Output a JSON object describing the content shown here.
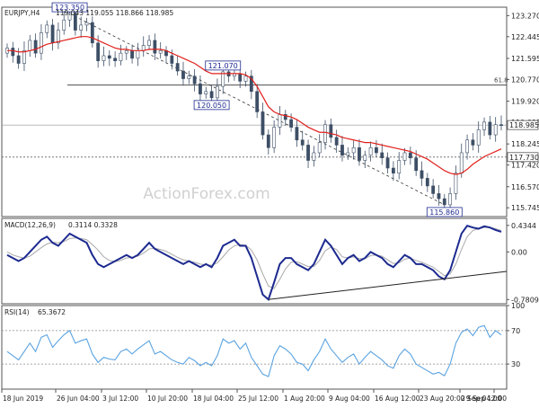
{
  "colors": {
    "background": "#ffffff",
    "border": "#555555",
    "price_bars": "#3d4f66",
    "ma": "#e0201b",
    "macd": "#1d2a90",
    "signal": "#a9a9a9",
    "rsi": "#5aa3e0",
    "trendline": "#222222",
    "dotted": "#333333",
    "label_box_border": "#1d2a90",
    "label_text": "#1d2a90",
    "price_label_bg": "#ffffff",
    "watermark": "#d0d0d0"
  },
  "watermark": "ActionForex.com",
  "chart_data": [
    {
      "panel": "price",
      "type": "candlestick",
      "header": {
        "symbol": "EURJPY,H4",
        "ohlc": "119.043 119.055 118.866 118.985"
      },
      "ylim": [
        115.4,
        123.6
      ],
      "y_ticks": [
        "123.270",
        "122.445",
        "121.595",
        "120.770",
        "119.920",
        "119.095",
        "118.245",
        "117.420",
        "116.570",
        "115.745"
      ],
      "y_tick_values": [
        123.27,
        122.445,
        121.595,
        120.77,
        119.92,
        119.095,
        118.245,
        117.42,
        116.57,
        115.745
      ],
      "x_tick_labels": [
        "18 Jun 2019",
        "26 Jun 04:00",
        "3 Jul 12:00",
        "10 Jul 20:00",
        "18 Jul 04:00",
        "25 Jul 12:00",
        "1 Aug 20:00",
        "9 Aug 04:00",
        "16 Aug 12:00",
        "23 Aug 20:00",
        "2 Sep 04:00",
        "9 Sep 12:00"
      ],
      "close_series": [
        122.0,
        121.7,
        121.4,
        121.9,
        122.3,
        121.8,
        122.6,
        122.9,
        122.2,
        122.7,
        123.1,
        123.35,
        122.7,
        122.9,
        123.0,
        122.2,
        121.5,
        121.7,
        121.6,
        121.5,
        121.8,
        121.9,
        121.6,
        121.9,
        122.1,
        122.3,
        121.8,
        121.9,
        121.7,
        121.4,
        121.1,
        120.8,
        120.9,
        120.6,
        120.2,
        120.3,
        120.05,
        120.5,
        121.07,
        120.9,
        121.0,
        120.7,
        120.9,
        120.3,
        119.5,
        118.6,
        118.1,
        118.9,
        119.4,
        119.2,
        118.9,
        118.4,
        118.2,
        117.6,
        117.9,
        118.3,
        119.0,
        118.5,
        118.2,
        117.8,
        117.9,
        118.1,
        117.6,
        117.8,
        118.1,
        117.9,
        117.7,
        117.3,
        117.1,
        117.6,
        117.9,
        117.7,
        117.2,
        116.9,
        116.6,
        116.3,
        116.1,
        115.86,
        116.3,
        117.1,
        117.9,
        118.4,
        118.2,
        118.8,
        119.1,
        118.6,
        119.0,
        118.985
      ],
      "ma_series": [
        121.9,
        121.9,
        121.85,
        121.85,
        121.9,
        121.95,
        122.05,
        122.15,
        122.2,
        122.25,
        122.3,
        122.35,
        122.4,
        122.45,
        122.45,
        122.4,
        122.3,
        122.2,
        122.1,
        122.0,
        121.95,
        121.95,
        121.9,
        121.9,
        121.9,
        121.95,
        121.95,
        121.95,
        121.9,
        121.8,
        121.7,
        121.6,
        121.5,
        121.4,
        121.25,
        121.1,
        121.0,
        121.0,
        121.0,
        121.0,
        121.0,
        121.0,
        120.95,
        120.8,
        120.5,
        120.1,
        119.7,
        119.5,
        119.4,
        119.35,
        119.3,
        119.2,
        119.05,
        118.9,
        118.8,
        118.7,
        118.7,
        118.65,
        118.6,
        118.5,
        118.45,
        118.4,
        118.35,
        118.3,
        118.3,
        118.25,
        118.2,
        118.15,
        118.1,
        118.05,
        118.0,
        117.95,
        117.85,
        117.75,
        117.65,
        117.5,
        117.35,
        117.2,
        117.1,
        117.05,
        117.1,
        117.25,
        117.45,
        117.6,
        117.75,
        117.85,
        117.95,
        118.05
      ],
      "annotations": [
        {
          "text": "123.350",
          "value": 123.35,
          "index": 11,
          "place": "above"
        },
        {
          "text": "121.070",
          "value": 121.07,
          "index": 38,
          "place": "above"
        },
        {
          "text": "120.050",
          "value": 120.05,
          "index": 36,
          "place": "below"
        },
        {
          "text": "115.860",
          "value": 115.86,
          "index": 77,
          "place": "below"
        }
      ],
      "fib": {
        "label": "61.8",
        "value": 120.55
      },
      "hlines": [
        {
          "value": 118.985,
          "style": "thin",
          "label": "118.985"
        },
        {
          "value": 117.73,
          "style": "dotted",
          "label": "117.730"
        }
      ],
      "trendline_from": [
        11,
        123.35
      ],
      "trendline_to": [
        77,
        115.86
      ]
    },
    {
      "panel": "macd",
      "type": "line",
      "header": {
        "name": "MACD(12,26,9)",
        "values": "0.3114 0.3328"
      },
      "ylim": [
        -0.85,
        0.55
      ],
      "y_ticks": [
        "0.4344",
        "0.00",
        "-0.7809"
      ],
      "y_tick_values": [
        0.4344,
        0.0,
        -0.7809
      ],
      "series": [
        {
          "name": "MACD",
          "values": [
            -0.05,
            -0.1,
            -0.15,
            -0.1,
            0.0,
            0.1,
            0.2,
            0.25,
            0.15,
            0.1,
            0.2,
            0.3,
            0.25,
            0.2,
            0.15,
            -0.05,
            -0.2,
            -0.25,
            -0.2,
            -0.15,
            -0.1,
            -0.05,
            -0.1,
            -0.05,
            0.05,
            0.15,
            0.05,
            0.0,
            -0.05,
            -0.1,
            -0.15,
            -0.2,
            -0.15,
            -0.2,
            -0.25,
            -0.2,
            -0.25,
            -0.1,
            0.1,
            0.15,
            0.2,
            0.1,
            0.1,
            -0.1,
            -0.4,
            -0.7,
            -0.78,
            -0.5,
            -0.2,
            -0.1,
            -0.1,
            -0.2,
            -0.25,
            -0.3,
            -0.2,
            0.0,
            0.2,
            0.1,
            -0.05,
            -0.2,
            -0.1,
            -0.05,
            -0.15,
            -0.1,
            0.0,
            -0.05,
            -0.1,
            -0.2,
            -0.25,
            -0.15,
            -0.05,
            -0.1,
            -0.2,
            -0.2,
            -0.25,
            -0.3,
            -0.4,
            -0.45,
            -0.3,
            0.0,
            0.3,
            0.43,
            0.4,
            0.38,
            0.42,
            0.4,
            0.36,
            0.33
          ]
        },
        {
          "name": "Signal",
          "values": [
            0.0,
            -0.05,
            -0.08,
            -0.1,
            -0.07,
            0.0,
            0.07,
            0.13,
            0.16,
            0.15,
            0.17,
            0.22,
            0.23,
            0.22,
            0.2,
            0.12,
            0.03,
            -0.08,
            -0.14,
            -0.16,
            -0.14,
            -0.1,
            -0.09,
            -0.07,
            -0.02,
            0.05,
            0.06,
            0.04,
            0.01,
            -0.04,
            -0.09,
            -0.13,
            -0.15,
            -0.17,
            -0.2,
            -0.21,
            -0.22,
            -0.18,
            -0.08,
            0.03,
            0.1,
            0.12,
            0.11,
            0.03,
            -0.13,
            -0.36,
            -0.56,
            -0.6,
            -0.45,
            -0.28,
            -0.17,
            -0.16,
            -0.2,
            -0.24,
            -0.24,
            -0.14,
            0.02,
            0.08,
            0.04,
            -0.08,
            -0.1,
            -0.08,
            -0.11,
            -0.11,
            -0.06,
            -0.05,
            -0.07,
            -0.13,
            -0.19,
            -0.18,
            -0.12,
            -0.1,
            -0.14,
            -0.17,
            -0.21,
            -0.25,
            -0.32,
            -0.39,
            -0.36,
            -0.2,
            0.04,
            0.25,
            0.35,
            0.38,
            0.4,
            0.4,
            0.38,
            0.35
          ]
        }
      ],
      "trendline_from": [
        46,
        -0.78
      ],
      "trendline_to": [
        87,
        -0.32
      ]
    },
    {
      "panel": "rsi",
      "type": "line",
      "header": {
        "name": "RSI(14)",
        "values": "65.3672"
      },
      "ylim": [
        0,
        100
      ],
      "y_ticks": [
        "100",
        "70",
        "30",
        "0"
      ],
      "y_tick_values": [
        100,
        70,
        30,
        0
      ],
      "series": [
        {
          "name": "RSI",
          "values": [
            45,
            40,
            35,
            45,
            55,
            45,
            62,
            65,
            50,
            58,
            65,
            70,
            55,
            58,
            60,
            42,
            32,
            38,
            36,
            35,
            45,
            48,
            42,
            48,
            53,
            58,
            42,
            45,
            40,
            35,
            32,
            30,
            38,
            34,
            28,
            32,
            28,
            40,
            60,
            55,
            58,
            48,
            55,
            38,
            28,
            18,
            15,
            40,
            52,
            48,
            42,
            32,
            30,
            22,
            35,
            45,
            60,
            48,
            40,
            32,
            38,
            42,
            30,
            38,
            45,
            40,
            35,
            28,
            25,
            40,
            48,
            42,
            30,
            26,
            22,
            18,
            20,
            16,
            30,
            55,
            68,
            72,
            64,
            74,
            76,
            62,
            70,
            65
          ]
        }
      ],
      "dotted_levels": [
        70,
        30
      ]
    }
  ]
}
